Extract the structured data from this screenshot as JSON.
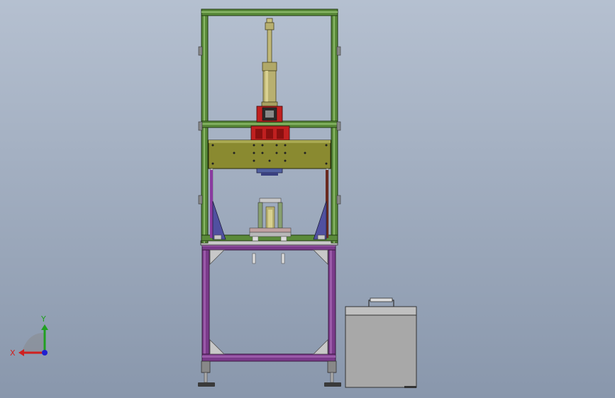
{
  "viewport": {
    "background_top": "#b5c0d0",
    "background_bottom": "#8997ac"
  },
  "colors": {
    "frame_upper_green": "#5a8a3a",
    "frame_lower_purple": "#7a3a8a",
    "cylinder_olive": "#b8b070",
    "clamp_red": "#c02020",
    "mounting_plate_olive": "#8a8a30",
    "side_bracket_blue": "#5050a0",
    "box_gray": "#a8a8a8"
  },
  "triad": {
    "x_label": "X",
    "y_label": "Y",
    "x_color": "#d02020",
    "y_color": "#20a020",
    "z_color": "#2020d0"
  },
  "objects": {
    "machine_frame": "assembly",
    "side_box": "part"
  }
}
